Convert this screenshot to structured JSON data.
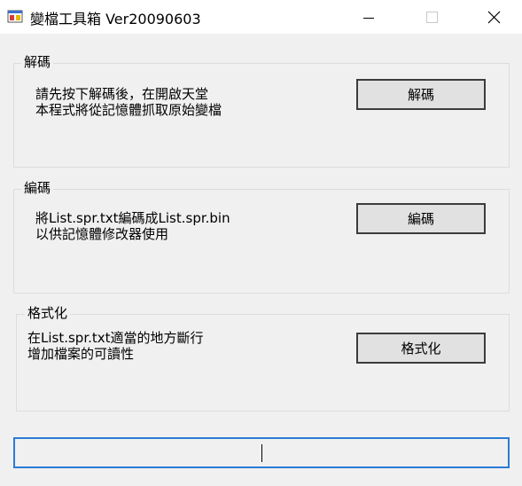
{
  "window": {
    "title": "變檔工具箱 Ver20090603",
    "icon": "app-icon",
    "controls": [
      "minimize-icon",
      "maximize-icon",
      "close-icon"
    ]
  },
  "groups": [
    {
      "label": "解碼",
      "description_lines": [
        "請先按下解碼後，在開啟天堂",
        "本程式將從記憶體抓取原始變檔"
      ],
      "button_label": "解碼"
    },
    {
      "label": "編碼",
      "description_lines": [
        "將List.spr.txt編碼成List.spr.bin",
        "以供記憶體修改器使用"
      ],
      "button_label": "編碼"
    },
    {
      "label": "格式化",
      "description_lines": [
        "在List.spr.txt適當的地方斷行",
        "增加檔案的可讀性"
      ],
      "button_label": "格式化"
    }
  ],
  "status_field": {
    "value": ""
  },
  "colors": {
    "focus_border": "#2a7bd6",
    "window_bg": "#f0f0f0",
    "button_bg": "#e1e1e1"
  }
}
